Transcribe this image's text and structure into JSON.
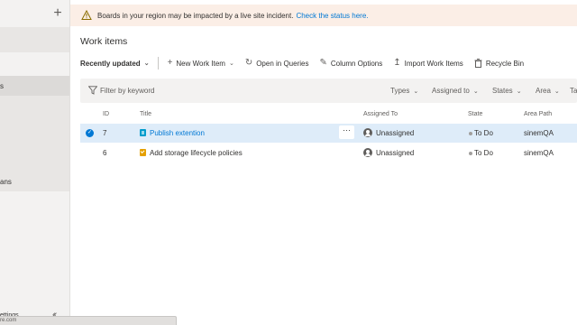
{
  "sidebar": {
    "add_icon": "plus-icon",
    "item_partial_1": "s",
    "item_partial_2": "ans",
    "item_partial_3": "ettings",
    "collapse_icon": "double-chevron-left-icon"
  },
  "status_popup": {
    "text": "re.com"
  },
  "banner": {
    "icon": "warning-icon",
    "message": "Boards in your region may be impacted by a live site incident.",
    "link": "Check the status here."
  },
  "page": {
    "title": "Work items"
  },
  "toolbar": {
    "view_selector": "Recently updated",
    "new_work_item": "New Work Item",
    "open_in_queries": "Open in Queries",
    "column_options": "Column Options",
    "import_work_items": "Import Work Items",
    "recycle_bin": "Recycle Bin"
  },
  "filter": {
    "placeholder": "Filter by keyword",
    "types": "Types",
    "assigned_to": "Assigned to",
    "states": "States",
    "area": "Area",
    "tags_partial": "Ta"
  },
  "grid": {
    "columns": {
      "id": "ID",
      "title": "Title",
      "assigned_to": "Assigned To",
      "state": "State",
      "area_path": "Area Path"
    },
    "rows": [
      {
        "id": "7",
        "type_icon": "task-icon",
        "title": "Publish extention",
        "assigned_to": "Unassigned",
        "state": "To Do",
        "area_path": "sinemQA",
        "selected": true
      },
      {
        "id": "6",
        "type_icon": "product-backlog-item-icon",
        "title": "Add storage lifecycle policies",
        "assigned_to": "Unassigned",
        "state": "To Do",
        "area_path": "sinemQA",
        "selected": false
      }
    ],
    "more_actions": "···"
  },
  "colors": {
    "accent": "#0078d4",
    "selected_row": "#deecf9",
    "banner_bg": "#fbeee6",
    "warning": "#c19c00"
  }
}
